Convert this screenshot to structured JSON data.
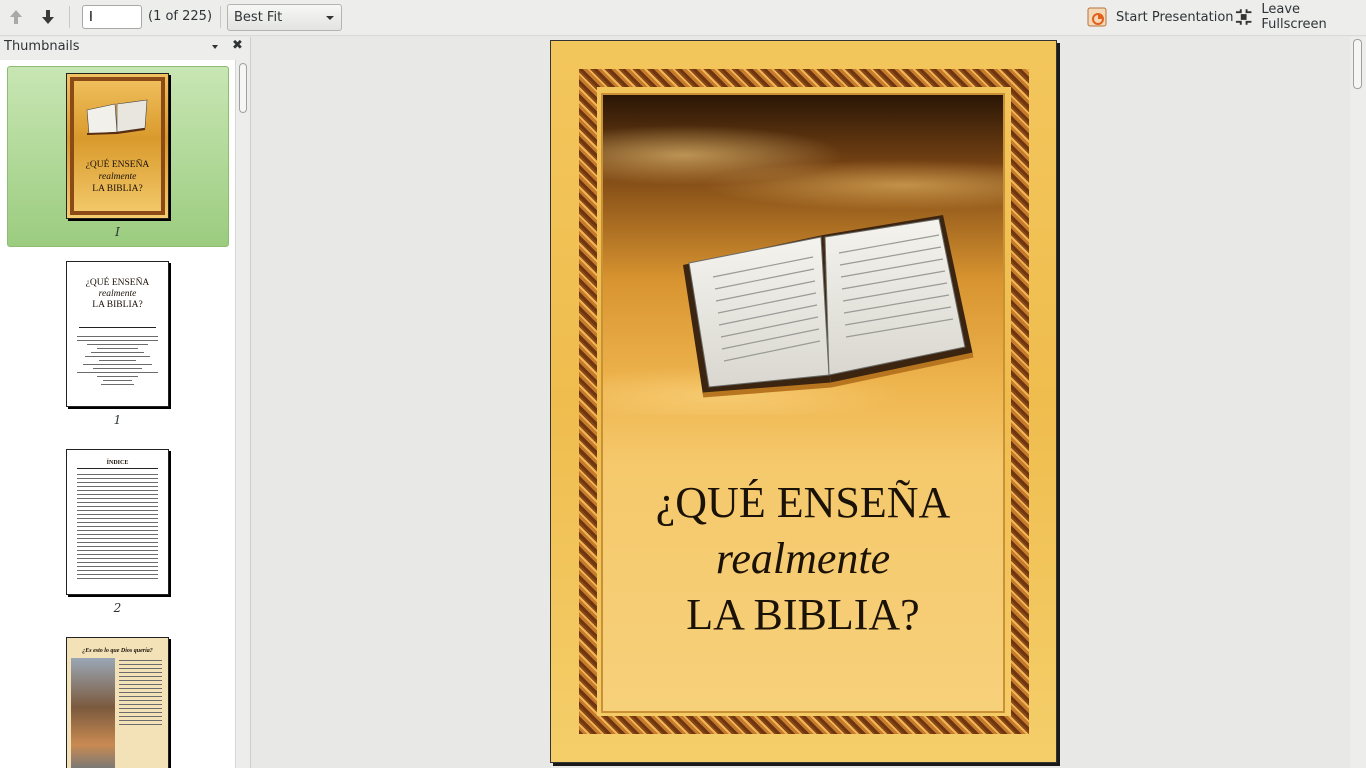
{
  "toolbar": {
    "current_page": "I",
    "page_count": "(1 of 225)",
    "zoom": "Best Fit",
    "start_presentation": "Start Presentation",
    "leave_fullscreen": "Leave Fullscreen"
  },
  "sidebar": {
    "title": "Thumbnails",
    "thumbnails": [
      {
        "label": "I"
      },
      {
        "label": "1"
      },
      {
        "label": "2"
      },
      {
        "label": ""
      }
    ],
    "thumb_cover_title": [
      "¿QUÉ ENSEÑA",
      "realmente",
      "LA BIBLIA?"
    ],
    "thumb_2_heading": "ÍNDICE",
    "thumb_3_heading": "¿Es esto lo que Dios quería?"
  },
  "document": {
    "cover_title": {
      "line1": "¿QUÉ ENSEÑA",
      "line2": "realmente",
      "line3": "LA BIBLIA?"
    }
  },
  "colors": {
    "selection": "#9bcc7f",
    "cover_gold": "#f3c65c",
    "frame_brown": "#9c5a1e"
  }
}
